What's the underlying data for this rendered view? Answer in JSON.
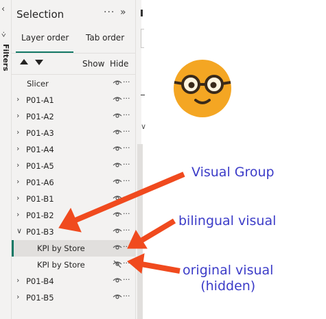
{
  "filters_strip": {
    "label": "Filters",
    "collapse_icon": "chevron-left-icon",
    "filter_icon": "funnel-icon"
  },
  "selection_pane": {
    "title": "Selection",
    "more_icon": "more-options-icon",
    "collapse_icon": "double-chevron-right-icon",
    "tabs": [
      {
        "label": "Layer order",
        "active": true
      },
      {
        "label": "Tab order",
        "active": false
      }
    ],
    "move_up_icon": "triangle-up-icon",
    "move_down_icon": "triangle-down-icon",
    "show_all_label": "Show",
    "hide_all_label": "Hide",
    "accent_color": "#117865",
    "layers": [
      {
        "label": "Slicer",
        "group": false,
        "indent": false,
        "visible": true,
        "selected": false
      },
      {
        "label": "P01-A1",
        "group": true,
        "expanded": false,
        "indent": false,
        "visible": true,
        "selected": false
      },
      {
        "label": "P01-A2",
        "group": true,
        "expanded": false,
        "indent": false,
        "visible": true,
        "selected": false
      },
      {
        "label": "P01-A3",
        "group": true,
        "expanded": false,
        "indent": false,
        "visible": true,
        "selected": false
      },
      {
        "label": "P01-A4",
        "group": true,
        "expanded": false,
        "indent": false,
        "visible": true,
        "selected": false
      },
      {
        "label": "P01-A5",
        "group": true,
        "expanded": false,
        "indent": false,
        "visible": true,
        "selected": false
      },
      {
        "label": "P01-A6",
        "group": true,
        "expanded": false,
        "indent": false,
        "visible": true,
        "selected": false
      },
      {
        "label": "P01-B1",
        "group": true,
        "expanded": false,
        "indent": false,
        "visible": true,
        "selected": false
      },
      {
        "label": "P01-B2",
        "group": true,
        "expanded": false,
        "indent": false,
        "visible": true,
        "selected": false
      },
      {
        "label": "P01-B3",
        "group": true,
        "expanded": true,
        "indent": false,
        "visible": true,
        "selected": false
      },
      {
        "label": "KPI by Store",
        "group": false,
        "indent": true,
        "visible": true,
        "selected": true
      },
      {
        "label": "KPI by Store",
        "group": false,
        "indent": true,
        "visible": false,
        "selected": false
      },
      {
        "label": "P01-B4",
        "group": true,
        "expanded": false,
        "indent": false,
        "visible": true,
        "selected": false
      },
      {
        "label": "P01-B5",
        "group": true,
        "expanded": false,
        "indent": false,
        "visible": true,
        "selected": false
      }
    ]
  },
  "annotations": {
    "color": "#3c3cc8",
    "arrow_color": "#f04a1e",
    "visual_group": "Visual Group",
    "bilingual_visual": "bilingual visual",
    "original_visual_line1": "original visual",
    "original_visual_line2": "(hidden)"
  },
  "face": {
    "fill_color": "#f4a623",
    "icon": "nerd-face-icon"
  }
}
